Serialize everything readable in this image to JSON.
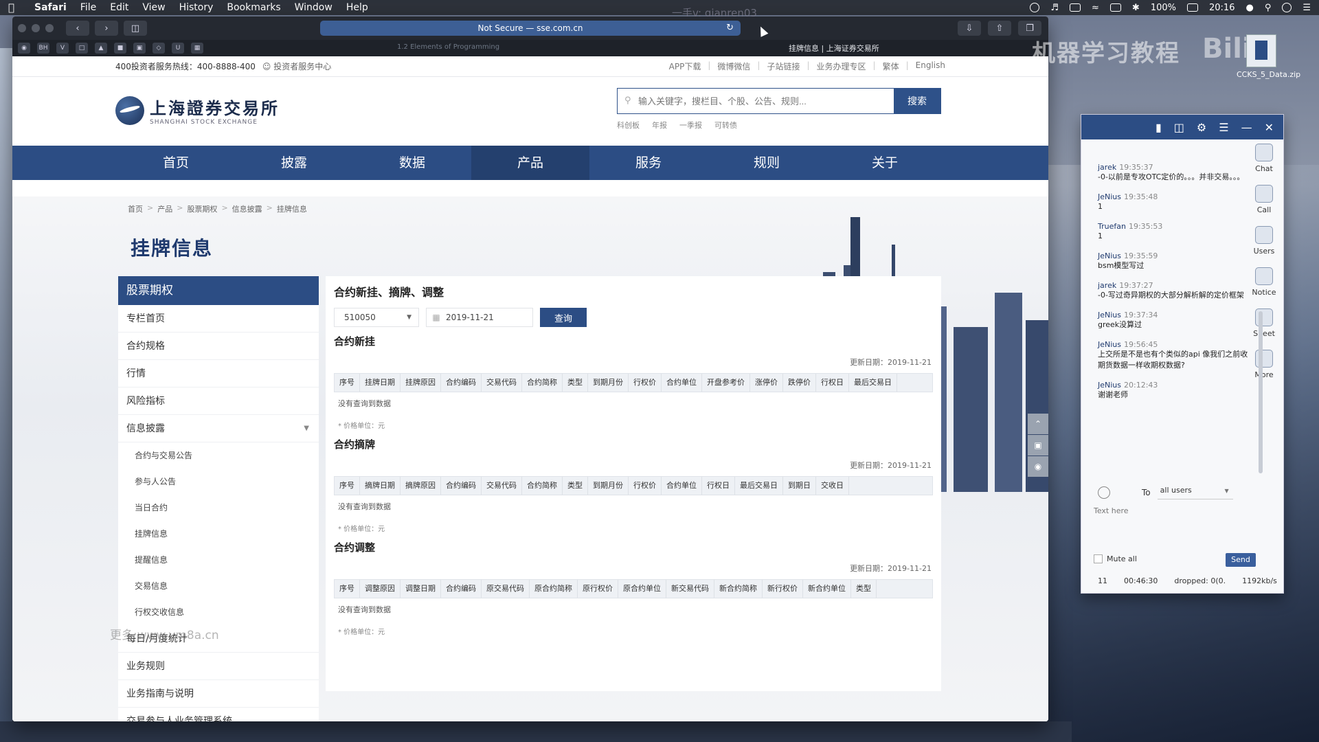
{
  "menubar": {
    "app": "Safari",
    "items": [
      "File",
      "Edit",
      "View",
      "History",
      "Bookmarks",
      "Window",
      "Help"
    ],
    "battery": "100%",
    "time": "20:16"
  },
  "safari": {
    "address": "Not Secure — sse.com.cn",
    "tab_left": "1.2 Elements of Programming",
    "tab_right": "挂牌信息 | 上海证券交易所"
  },
  "overlay": {
    "top_text": "一手v: qianren03",
    "bili_text": "机器学习教程",
    "bili_logo": "Bili",
    "desktop_file": "CCKS_5_Data.zip",
    "watermark": "更多:www.ym8a.cn"
  },
  "site": {
    "hotline_label": "400投资者服务热线：",
    "hotline": "400-8888-400",
    "investor_center": "投资者服务中心",
    "top_links": [
      "APP下载",
      "微博微信",
      "子站链接",
      "业务办理专区",
      "繁体",
      "English"
    ],
    "logo_cn": "上海證券交易所",
    "logo_en": "SHANGHAI STOCK EXCHANGE",
    "search_placeholder": "输入关键字，搜栏目、个股、公告、规则...",
    "search_button": "搜索",
    "hot_words": [
      "科创板",
      "年报",
      "一季报",
      "可转债"
    ],
    "nav": [
      "首页",
      "披露",
      "数据",
      "产品",
      "服务",
      "规则",
      "关于"
    ],
    "breadcrumb": [
      "首页",
      "产品",
      "股票期权",
      "信息披露",
      "挂牌信息"
    ],
    "page_title": "挂牌信息"
  },
  "sidebar": {
    "header": "股票期权",
    "items": [
      "专栏首页",
      "合约规格",
      "行情",
      "风险指标",
      "信息披露"
    ],
    "sub_items": [
      "合约与交易公告",
      "参与人公告",
      "当日合约",
      "挂牌信息",
      "提醒信息",
      "交易信息",
      "行权交收信息"
    ],
    "items_after": [
      "每日/月度统计",
      "业务规则",
      "业务指南与说明",
      "交易参与人业务管理系统"
    ]
  },
  "content": {
    "title": "合约新挂、摘牌、调整",
    "select_value": "510050",
    "date_value": "2019-11-21",
    "query_button": "查询",
    "sections": [
      {
        "title": "合约新挂",
        "updated": "更新日期：2019-11-21",
        "columns": [
          "序号",
          "挂牌日期",
          "挂牌原因",
          "合约编码",
          "交易代码",
          "合约简称",
          "类型",
          "到期月份",
          "行权价",
          "合约单位",
          "开盘参考价",
          "涨停价",
          "跌停价",
          "行权日",
          "最后交易日"
        ],
        "empty": "没有查询到数据",
        "unit": "* 价格单位：元"
      },
      {
        "title": "合约摘牌",
        "updated": "更新日期：2019-11-21",
        "columns": [
          "序号",
          "摘牌日期",
          "摘牌原因",
          "合约编码",
          "交易代码",
          "合约简称",
          "类型",
          "到期月份",
          "行权价",
          "合约单位",
          "行权日",
          "最后交易日",
          "到期日",
          "交收日"
        ],
        "empty": "没有查询到数据",
        "unit": "* 价格单位：元"
      },
      {
        "title": "合约调整",
        "updated": "更新日期：2019-11-21",
        "columns": [
          "序号",
          "调整原因",
          "调整日期",
          "合约编码",
          "原交易代码",
          "原合约简称",
          "原行权价",
          "原合约单位",
          "新交易代码",
          "新合约简称",
          "新行权价",
          "新合约单位",
          "类型"
        ],
        "empty": "没有查询到数据",
        "unit": "* 价格单位：元"
      }
    ]
  },
  "chat": {
    "side_buttons": [
      "Chat",
      "Call",
      "Users",
      "Notice",
      "Sheet",
      "More"
    ],
    "messages": [
      {
        "user": "jarek",
        "time": "19:35:37",
        "text": "-0-以前是专攻OTC定价的。。。并非交易。。。"
      },
      {
        "user": "JeNius",
        "time": "19:35:48",
        "text": "1"
      },
      {
        "user": "Truefan",
        "time": "19:35:53",
        "text": "1"
      },
      {
        "user": "JeNius",
        "time": "19:35:59",
        "text": "bsm模型写过"
      },
      {
        "user": "jarek",
        "time": "19:37:27",
        "text": "-0-写过奇异期权的大部分解析解的定价框架"
      },
      {
        "user": "JeNius",
        "time": "19:37:34",
        "text": "greek没算过"
      },
      {
        "user": "JeNius",
        "time": "19:56:45",
        "text": "上交所是不是也有个类似的api 像我们之前收期货数据一样收期权数据?"
      },
      {
        "user": "JeNius",
        "time": "20:12:43",
        "text": "谢谢老师"
      }
    ],
    "to_label": "To",
    "to_value": "all users",
    "text_placeholder": "Text here",
    "mute_all": "Mute all",
    "send": "Send",
    "status": [
      "11",
      "00:46:30",
      "dropped: 0(0.",
      "1192kb/s"
    ]
  }
}
